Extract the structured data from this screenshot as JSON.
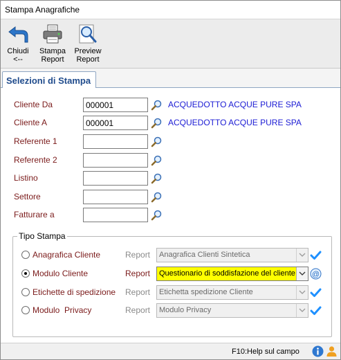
{
  "window": {
    "title": "Stampa Anagrafiche"
  },
  "toolbar": {
    "buttons": [
      {
        "label": "Chiudi\n<--",
        "icon": "back-arrow-icon"
      },
      {
        "label": "Stampa\nReport",
        "icon": "printer-icon"
      },
      {
        "label": "Preview\nReport",
        "icon": "magnifier-preview-icon"
      }
    ]
  },
  "tab": {
    "label": "Selezioni di Stampa"
  },
  "fields": {
    "cliente_da": {
      "label": "Cliente Da",
      "value": "000001",
      "description": "ACQUEDOTTO ACQUE PURE SPA"
    },
    "cliente_a": {
      "label": "Cliente A",
      "value": "000001",
      "description": "ACQUEDOTTO ACQUE PURE SPA"
    },
    "referente_1": {
      "label": "Referente 1",
      "value": ""
    },
    "referente_2": {
      "label": "Referente 2",
      "value": ""
    },
    "listino": {
      "label": "Listino",
      "value": ""
    },
    "settore": {
      "label": "Settore",
      "value": ""
    },
    "fatturare_a": {
      "label": "Fatturare a",
      "value": ""
    }
  },
  "tipo_stampa": {
    "legend": "Tipo Stampa",
    "report_label": "Report",
    "options": [
      {
        "label": "Anagrafica Cliente",
        "selected": false,
        "report": "Anagrafica Clienti Sintetica"
      },
      {
        "label": "Modulo Cliente",
        "selected": true,
        "report": "Questionario di soddisfazione del cliente"
      },
      {
        "label": "Etichette di spedizione",
        "selected": false,
        "report": "Etichetta spedizione Cliente"
      },
      {
        "label": "Modulo  Privacy",
        "selected": false,
        "report": "Modulo Privacy"
      }
    ]
  },
  "status": {
    "help": "F10:Help sul campo"
  },
  "colors": {
    "label": "#7a1a1a",
    "description": "#1a1ad4",
    "tab_text": "#1f4b8c",
    "highlight": "#ffff00",
    "tick": "#1e90ff"
  }
}
